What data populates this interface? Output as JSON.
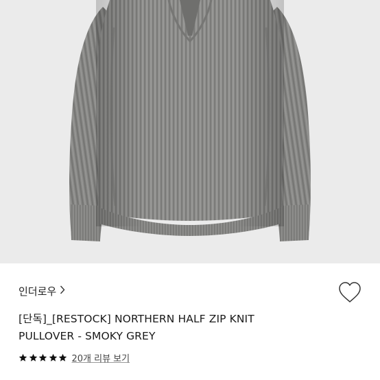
{
  "product": {
    "image_alt": "smoky grey half zip knit pullover",
    "brand": "인더로우",
    "title_line1": "[단독]_[RESTOCK] NORTHERN HALF ZIP KNIT",
    "title_line2": "PULLOVER - SMOKY GREY",
    "rating": {
      "stars": 5,
      "max": 5
    },
    "review_link": "20개 리뷰 보기"
  },
  "icons": {
    "brand_chevron": "chevron-right-icon",
    "wishlist": "heart-outline-icon",
    "star": "star-filled-icon"
  },
  "colors": {
    "image_background": "#ebebeb",
    "sweater": "#8f8f8d",
    "star": "#111111"
  }
}
